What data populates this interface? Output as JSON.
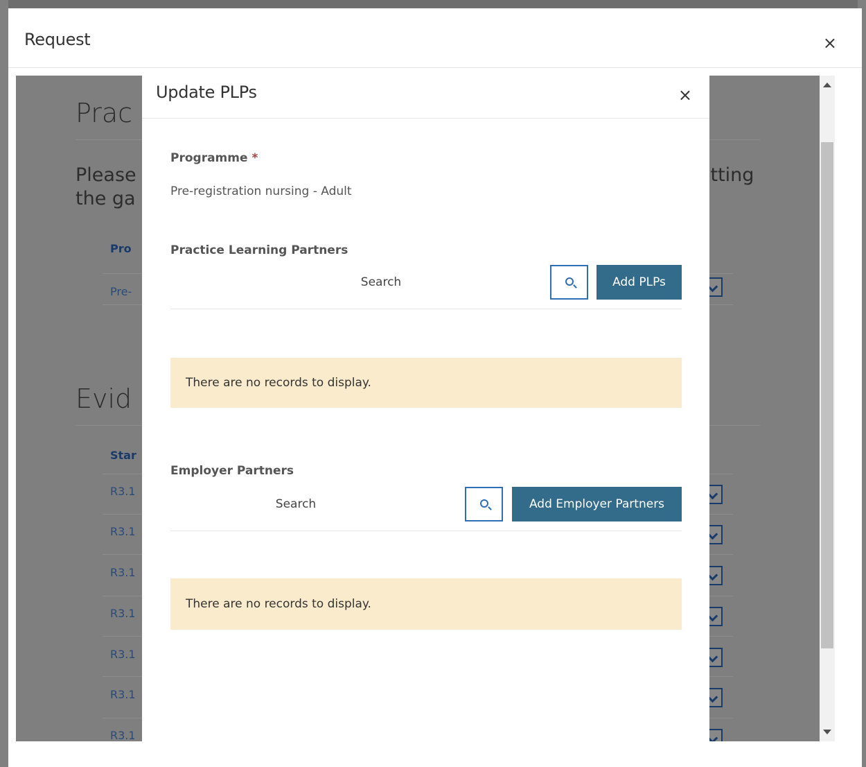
{
  "outer_modal": {
    "title": "Request",
    "close_icon": "×"
  },
  "background_page": {
    "heading_1": "Prac",
    "paragraph_line_1": "Please",
    "paragraph_line_1_right": "itting",
    "paragraph_line_2": "the ga",
    "table_1_header": "Pro",
    "table_1_row": "Pre-",
    "heading_2": "Evid",
    "table_2_header": "Star",
    "table_2_rows": [
      "R3.1",
      "R3.1",
      "R3.1",
      "R3.1",
      "R3.1",
      "R3.1",
      "R3.1"
    ]
  },
  "inner_modal": {
    "title": "Update PLPs",
    "close_icon": "×",
    "programme": {
      "label": "Programme",
      "required_mark": "*",
      "value": "Pre-registration nursing - Adult"
    },
    "plp_section": {
      "label": "Practice Learning Partners",
      "search_placeholder": "Search",
      "add_button": "Add PLPs",
      "empty_message": "There are no records to display."
    },
    "employer_section": {
      "label": "Employer Partners",
      "search_placeholder": "Search",
      "add_button": "Add Employer Partners",
      "empty_message": "There are no records to display."
    }
  }
}
